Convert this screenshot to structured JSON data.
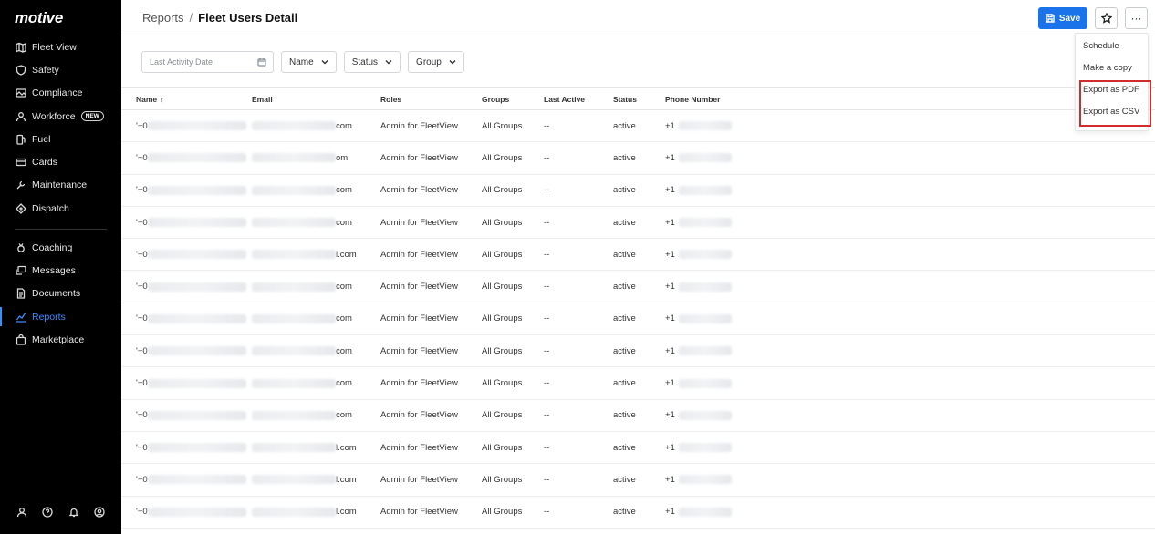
{
  "brand": {
    "logo_text": "motive"
  },
  "sidebar": {
    "items_top": [
      {
        "label": "Fleet View",
        "icon": "map-icon"
      },
      {
        "label": "Safety",
        "icon": "shield-icon"
      },
      {
        "label": "Compliance",
        "icon": "image-icon"
      },
      {
        "label": "Workforce",
        "icon": "person-icon",
        "badge": "NEW"
      },
      {
        "label": "Fuel",
        "icon": "fuel-icon"
      },
      {
        "label": "Cards",
        "icon": "card-icon"
      },
      {
        "label": "Maintenance",
        "icon": "wrench-icon"
      },
      {
        "label": "Dispatch",
        "icon": "tag-icon"
      }
    ],
    "items_bottom": [
      {
        "label": "Coaching",
        "icon": "medal-icon"
      },
      {
        "label": "Messages",
        "icon": "chat-icon"
      },
      {
        "label": "Documents",
        "icon": "document-icon"
      },
      {
        "label": "Reports",
        "icon": "chart-icon",
        "active": true
      },
      {
        "label": "Marketplace",
        "icon": "bag-icon"
      }
    ],
    "footer_icons": [
      "user-icon",
      "help-icon",
      "bell-icon",
      "account-icon"
    ]
  },
  "header": {
    "crumb_parent": "Reports",
    "crumb_sep": "/",
    "crumb_current": "Fleet Users Detail",
    "save_label": "Save"
  },
  "filters": {
    "date_placeholder": "Last Activity Date",
    "name": "Name",
    "status": "Status",
    "group": "Group"
  },
  "table": {
    "columns": [
      "Name",
      "Email",
      "Roles",
      "Groups",
      "Last Active",
      "Status",
      "Phone Number"
    ],
    "rows": [
      {
        "name_prefix": "'+0",
        "email_suffix": "com",
        "role": "Admin for FleetView",
        "group": "All Groups",
        "last_active": "--",
        "status": "active",
        "phone_prefix": "+1"
      },
      {
        "name_prefix": "'+0",
        "email_suffix": "om",
        "role": "Admin for FleetView",
        "group": "All Groups",
        "last_active": "--",
        "status": "active",
        "phone_prefix": "+1"
      },
      {
        "name_prefix": "'+0",
        "email_suffix": "com",
        "role": "Admin for FleetView",
        "group": "All Groups",
        "last_active": "--",
        "status": "active",
        "phone_prefix": "+1"
      },
      {
        "name_prefix": "'+0",
        "email_suffix": "com",
        "role": "Admin for FleetView",
        "group": "All Groups",
        "last_active": "--",
        "status": "active",
        "phone_prefix": "+1"
      },
      {
        "name_prefix": "'+0",
        "email_suffix": "l.com",
        "role": "Admin for FleetView",
        "group": "All Groups",
        "last_active": "--",
        "status": "active",
        "phone_prefix": "+1"
      },
      {
        "name_prefix": "'+0",
        "email_suffix": "com",
        "role": "Admin for FleetView",
        "group": "All Groups",
        "last_active": "--",
        "status": "active",
        "phone_prefix": "+1"
      },
      {
        "name_prefix": "'+0",
        "email_suffix": "com",
        "role": "Admin for FleetView",
        "group": "All Groups",
        "last_active": "--",
        "status": "active",
        "phone_prefix": "+1"
      },
      {
        "name_prefix": "'+0",
        "email_suffix": "com",
        "role": "Admin for FleetView",
        "group": "All Groups",
        "last_active": "--",
        "status": "active",
        "phone_prefix": "+1"
      },
      {
        "name_prefix": "'+0",
        "email_suffix": "com",
        "role": "Admin for FleetView",
        "group": "All Groups",
        "last_active": "--",
        "status": "active",
        "phone_prefix": "+1"
      },
      {
        "name_prefix": "'+0",
        "email_suffix": "com",
        "role": "Admin for FleetView",
        "group": "All Groups",
        "last_active": "--",
        "status": "active",
        "phone_prefix": "+1"
      },
      {
        "name_prefix": "'+0",
        "email_suffix": "l.com",
        "role": "Admin for FleetView",
        "group": "All Groups",
        "last_active": "--",
        "status": "active",
        "phone_prefix": "+1"
      },
      {
        "name_prefix": "'+0",
        "email_suffix": "l.com",
        "role": "Admin for FleetView",
        "group": "All Groups",
        "last_active": "--",
        "status": "active",
        "phone_prefix": "+1"
      },
      {
        "name_prefix": "'+0",
        "email_suffix": "l.com",
        "role": "Admin for FleetView",
        "group": "All Groups",
        "last_active": "--",
        "status": "active",
        "phone_prefix": "+1"
      }
    ]
  },
  "menu": {
    "items": [
      "Schedule",
      "Make a copy",
      "Export as PDF",
      "Export as CSV"
    ]
  },
  "colors": {
    "accent": "#1a73e8",
    "sidebar_bg": "#000000",
    "active_nav": "#3a8dff",
    "highlight": "#d12b2b"
  }
}
